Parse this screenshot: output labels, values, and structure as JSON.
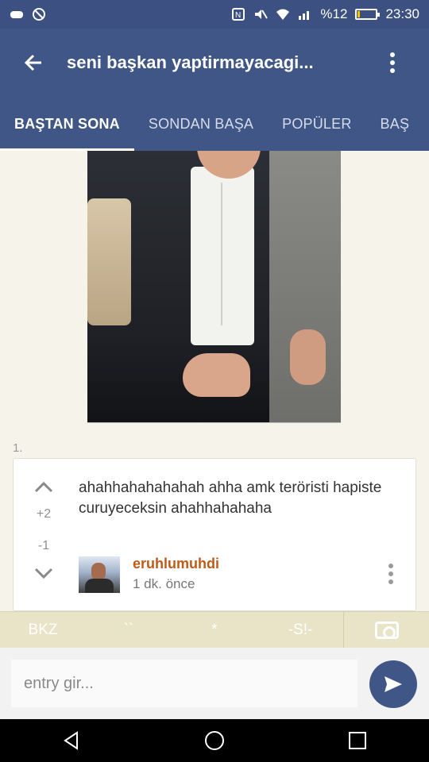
{
  "status_bar": {
    "battery": "%12",
    "time": "23:30",
    "icons": [
      "game-controller-icon",
      "no-location-icon",
      "nfc-icon",
      "mute-icon",
      "wifi-icon",
      "signal-icon",
      "battery-icon"
    ],
    "battery_level": 0.12
  },
  "app_bar": {
    "title": "seni başkan yaptirmayacagi...",
    "back_icon": "arrow-left-icon",
    "menu_icon": "kebab-icon"
  },
  "tabs": [
    {
      "label": "BAŞTAN SONA",
      "active": true
    },
    {
      "label": "SONDAN BAŞA",
      "active": false
    },
    {
      "label": "POPÜLER",
      "active": false
    },
    {
      "label": "BAŞ",
      "active": false
    }
  ],
  "entry": {
    "index": "1.",
    "text": "ahahhahahahahah ahha amk teröristi hapiste curuyeceksin ahahhahahaha",
    "upvotes": "+2",
    "downvotes": "-1",
    "author": "eruhlumuhdi",
    "time": "1 dk. önce"
  },
  "format_bar": {
    "bkz": "BKZ",
    "backtick": "``",
    "star": "*",
    "spoiler": "-S!-",
    "camera_icon": "camera-icon"
  },
  "composer": {
    "placeholder": "entry gir...",
    "send_icon": "send-icon"
  },
  "colors": {
    "primary": "#3f5687",
    "author": "#bf5a18",
    "format_bar": "#e9e3c8"
  }
}
